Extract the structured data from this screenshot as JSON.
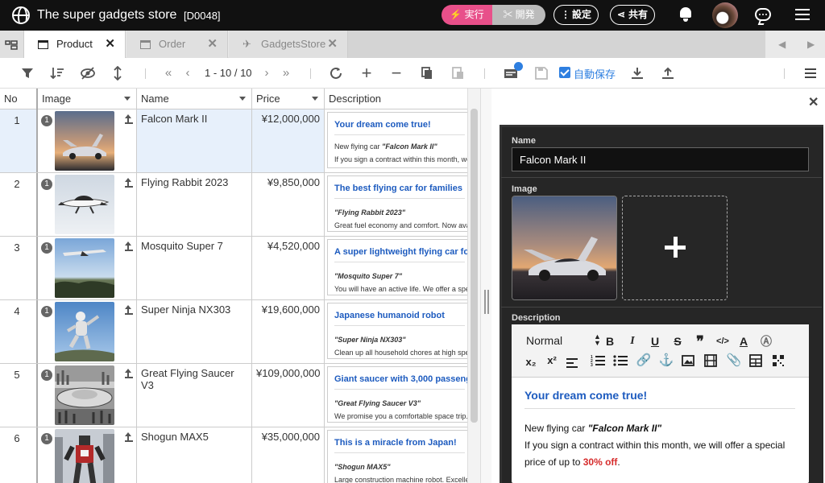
{
  "app": {
    "title": "The super gadgets store",
    "doc_id": "[D0048]",
    "run_label": "実行",
    "dev_label": "開発",
    "settings_label": "設定",
    "share_label": "共有"
  },
  "tabs": [
    {
      "label": "Product",
      "active": true
    },
    {
      "label": "Order",
      "active": false
    },
    {
      "label": "GadgetsStore",
      "active": false
    }
  ],
  "toolbar": {
    "page_range": "1 - 10 / 10",
    "autosave_label": "自動保存",
    "autosave_checked": true
  },
  "grid": {
    "columns": [
      "No",
      "Image",
      "Name",
      "Price",
      "Description"
    ],
    "rows": [
      {
        "no": "1",
        "img_count": "1",
        "name": "Falcon Mark II",
        "price": "¥12,000,000",
        "desc_title": "Your dream come true!",
        "desc_line1_prefix": "New flying car",
        "desc_line1_name": "\"Falcon Mark II\"",
        "desc_line2": "If you sign a contract within this month, we will offer a special",
        "selected": true
      },
      {
        "no": "2",
        "img_count": "1",
        "name": "Flying Rabbit 2023",
        "price": "¥9,850,000",
        "desc_title": "The best flying car for families",
        "desc_line1_name": "\"Flying Rabbit 2023\"",
        "desc_line2": "Great fuel economy and comfort. Now available"
      },
      {
        "no": "3",
        "img_count": "1",
        "name": "Mosquito Super 7",
        "price": "¥4,520,000",
        "desc_title": "A super lightweight flying car for c",
        "desc_line1_name": "\"Mosquito Super 7\"",
        "desc_line2": "You will have an active life. We offer a special"
      },
      {
        "no": "4",
        "img_count": "1",
        "name": "Super Ninja NX303",
        "price": "¥19,600,000",
        "desc_title": "Japanese humanoid robot",
        "desc_line1_name": "\"Super Ninja NX303\"",
        "desc_line2": "Clean up all household chores at high speed"
      },
      {
        "no": "5",
        "img_count": "1",
        "name": "Great Flying Saucer V3",
        "price": "¥109,000,000",
        "desc_title": "Giant saucer with 3,000 passenge",
        "desc_line1_name": "\"Great Flying Saucer V3\"",
        "desc_line2": "We promise you a comfortable space trip."
      },
      {
        "no": "6",
        "img_count": "1",
        "name": "Shogun MAX5",
        "price": "¥35,000,000",
        "desc_title": "This is a miracle from Japan!",
        "desc_line1_name": "\"Shogun MAX5\"",
        "desc_line2": "Large construction machine robot. Excellent"
      }
    ]
  },
  "panel": {
    "name_label": "Name",
    "name_value": "Falcon Mark II",
    "image_label": "Image",
    "description_label": "Description",
    "editor": {
      "format_select": "Normal",
      "heading": "Your dream come true!",
      "p1_prefix": "New flying car ",
      "p1_name": "\"Falcon Mark II\"",
      "p2_text": "If you sign a contract within this month, we will offer a special",
      "p3_prefix": "price of up to ",
      "p3_discount": "30% off",
      "p3_suffix": "."
    }
  },
  "colors": {
    "accent": "#2e7fe0",
    "run": "#e8508a",
    "link_blue": "#1d5bbf",
    "discount": "#d62b2b",
    "selected_row": "#e7f0fb"
  },
  "icons": [
    "globe-icon",
    "run-icon",
    "dev-icon",
    "settings-icon",
    "share-icon",
    "bell-icon",
    "avatar",
    "chat-icon",
    "menu-icon",
    "tree-icon",
    "table-icon",
    "plane-icon",
    "filter-icon",
    "sort-icon",
    "hide-icon",
    "row-height-icon",
    "first-page-icon",
    "prev-page-icon",
    "next-page-icon",
    "last-page-icon",
    "refresh-icon",
    "add-icon",
    "remove-icon",
    "copy-icon",
    "paste-icon",
    "card-icon",
    "save-icon",
    "download-icon",
    "upload-icon",
    "close-icon"
  ]
}
